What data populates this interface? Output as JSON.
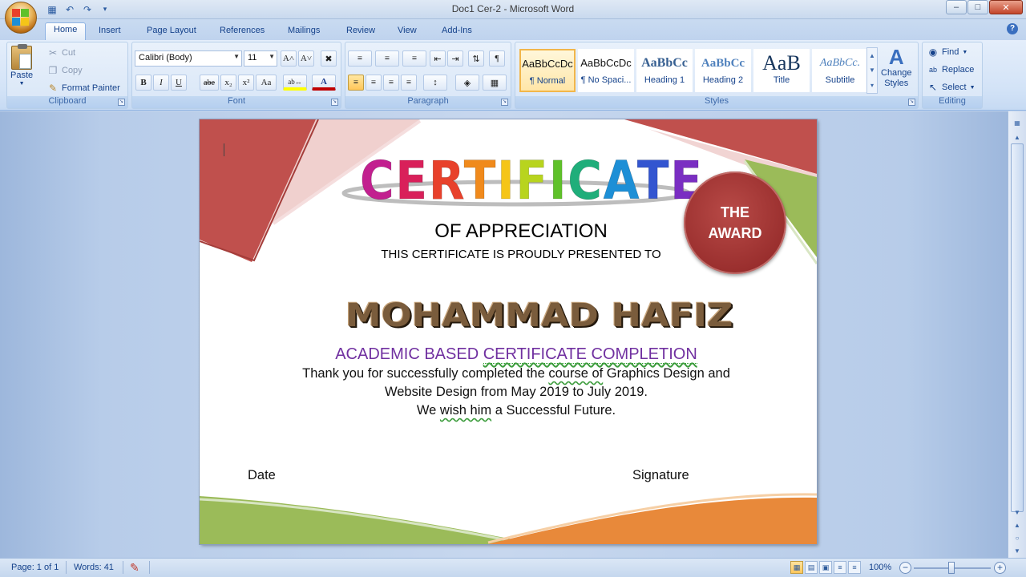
{
  "window": {
    "title": "Doc1 Cer-2 - Microsoft Word",
    "minimize": "–",
    "maximize": "□",
    "close": "✕",
    "help": "?"
  },
  "quick_access": [
    {
      "name": "save-icon",
      "glyph": "💾"
    },
    {
      "name": "undo-icon",
      "glyph": "↶"
    },
    {
      "name": "redo-icon",
      "glyph": "↷"
    },
    {
      "name": "customize-icon",
      "glyph": "▾"
    }
  ],
  "tabs": [
    "Home",
    "Insert",
    "Page Layout",
    "References",
    "Mailings",
    "Review",
    "View",
    "Add-Ins"
  ],
  "active_tab": "Home",
  "clipboard": {
    "paste": "Paste",
    "cut": "Cut",
    "copy": "Copy",
    "format_painter": "Format Painter",
    "label": "Clipboard"
  },
  "font": {
    "family": "Calibri (Body)",
    "size": "11",
    "grow": "A˄",
    "shrink": "A˅",
    "bold": "B",
    "italic": "I",
    "underline": "U",
    "strike": "abe",
    "subscript": "x₂",
    "superscript": "x²",
    "change_case": "Aa",
    "highlight": "ab↔",
    "font_color": "A",
    "label": "Font"
  },
  "paragraph": {
    "label": "Paragraph"
  },
  "styles": {
    "label": "Styles",
    "items": [
      {
        "sample": "AaBbCcDc",
        "name": "¶ Normal",
        "selected": true
      },
      {
        "sample": "AaBbCcDc",
        "name": "¶ No Spaci...",
        "selected": false
      },
      {
        "sample": "AaBbCc",
        "name": "Heading 1",
        "selected": false
      },
      {
        "sample": "AaBbCc",
        "name": "Heading 2",
        "selected": false
      },
      {
        "sample": "AaB",
        "name": "Title",
        "selected": false
      },
      {
        "sample": "AaBbCc.",
        "name": "Subtitle",
        "selected": false
      }
    ],
    "change_styles_1": "Change",
    "change_styles_2": "Styles"
  },
  "editing": {
    "find": "Find",
    "replace": "Replace",
    "select": "Select",
    "label": "Editing"
  },
  "document": {
    "title_letters": [
      {
        "ch": "C",
        "color": "#c21f8f"
      },
      {
        "ch": "E",
        "color": "#d9205a"
      },
      {
        "ch": "R",
        "color": "#e8412b"
      },
      {
        "ch": "T",
        "color": "#f08a1c"
      },
      {
        "ch": "I",
        "color": "#f5c518"
      },
      {
        "ch": "F",
        "color": "#b8d41e"
      },
      {
        "ch": "I",
        "color": "#5fc12a"
      },
      {
        "ch": "C",
        "color": "#1fae7a"
      },
      {
        "ch": "A",
        "color": "#1d8fd6"
      },
      {
        "ch": "T",
        "color": "#3355d0"
      },
      {
        "ch": "E",
        "color": "#7a2ec2"
      }
    ],
    "appreciation": "OF APPRECIATION",
    "presented": "THIS CERTIFICATE IS PROUDLY PRESENTED TO",
    "awardee": "MOHAMMAD HAFIZ",
    "award_line1": "THE",
    "award_line2": "AWARD",
    "academic_part1": "ACADEMIC BASED ",
    "academic_part2": "CERTIFICATE  COMPLETION",
    "body1_a": "Thank you for successfully completed the ",
    "body1_b": "course  of",
    "body1_c": " Graphics Design and",
    "body2": "Website Design from May 2019 to July 2019.",
    "body3_a": "We ",
    "body3_b": "wish  him",
    "body3_c": " a Successful Future.",
    "date": "Date",
    "signature": "Signature"
  },
  "status": {
    "page": "Page: 1 of 1",
    "words": "Words: 41",
    "zoom": "100%",
    "zoom_level_percent": 100
  },
  "colors": {
    "ribbon": "#d3e3f7",
    "accent_red": "#c0504d",
    "accent_green": "#9bbb59",
    "accent_orange": "#e8893a",
    "purple_text": "#7030a0"
  }
}
